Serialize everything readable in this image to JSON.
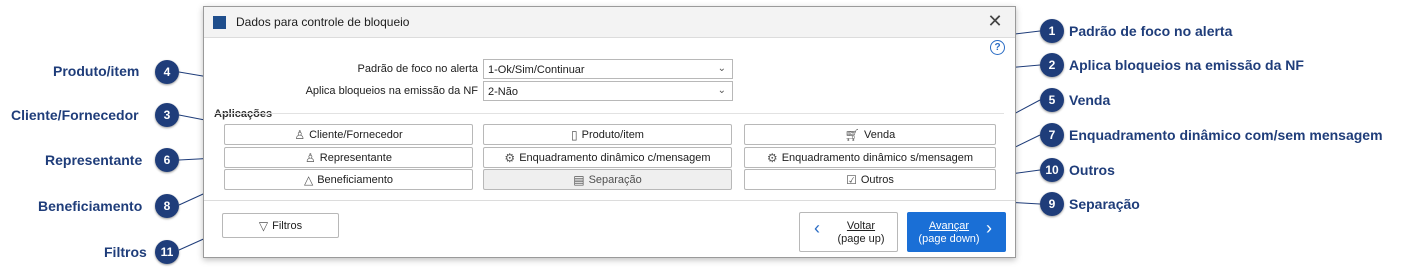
{
  "dialog": {
    "title": "Dados para controle de bloqueio",
    "close_glyph": "✕",
    "help_glyph": "?",
    "fields": [
      {
        "label": "Padrão de foco no alerta",
        "value": "1-Ok/Sim/Continuar"
      },
      {
        "label": "Aplica bloqueios na emissão da NF",
        "value": "2-Não"
      }
    ],
    "section_label": "Aplicações",
    "buttons": [
      {
        "label": "Cliente/Fornecedor",
        "icon": "person-icon"
      },
      {
        "label": "Produto/item",
        "icon": "product-icon"
      },
      {
        "label": "Venda",
        "icon": "cart-icon"
      },
      {
        "label": "Representante",
        "icon": "person-icon"
      },
      {
        "label": "Enquadramento dinâmico c/mensagem",
        "icon": "gear-icon"
      },
      {
        "label": "Enquadramento dinâmico s/mensagem",
        "icon": "gear-icon"
      },
      {
        "label": "Beneficiamento",
        "icon": "shapes-icon"
      },
      {
        "label": "Separação",
        "icon": "clipboard-icon"
      },
      {
        "label": "Outros",
        "icon": "checkbox-icon"
      }
    ],
    "filter_button": "Filtros",
    "back_button": {
      "line1": "Voltar",
      "line2": "(page up)"
    },
    "next_button": {
      "line1": "Avançar",
      "line2": "(page down)"
    }
  },
  "callouts": [
    {
      "num": "1",
      "text": "Padrão de foco no alerta"
    },
    {
      "num": "2",
      "text": "Aplica bloqueios na emissão da NF"
    },
    {
      "num": "3",
      "text": "Cliente/Fornecedor"
    },
    {
      "num": "4",
      "text": "Produto/item"
    },
    {
      "num": "5",
      "text": "Venda"
    },
    {
      "num": "6",
      "text": "Representante"
    },
    {
      "num": "7",
      "text": "Enquadramento dinâmico com/sem mensagem"
    },
    {
      "num": "8",
      "text": "Beneficiamento"
    },
    {
      "num": "9",
      "text": "Separação"
    },
    {
      "num": "10",
      "text": "Outros"
    },
    {
      "num": "11",
      "text": "Filtros"
    }
  ],
  "colors": {
    "callout": "#1f3d7a",
    "primary_button": "#1a6fd6"
  }
}
